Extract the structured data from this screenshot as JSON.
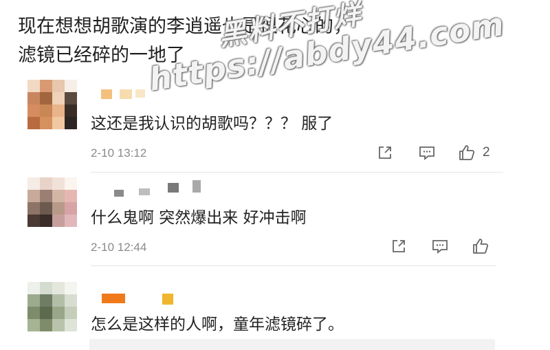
{
  "post": {
    "line1": "现在想想胡歌演的李逍遥也是很花心的，",
    "line2": "滤镜已经碎的一地了"
  },
  "watermark": {
    "line1": "黑料不打烊",
    "line2": "https://abdy44.com"
  },
  "comments": [
    {
      "text": "这还是我认识的胡歌吗？？？ 服了",
      "time": "2-10 13:12",
      "like_count": "2",
      "avatar_colors": [
        "#f2d9c4",
        "#d99a72",
        "#e7c7ad",
        "#f6eee7",
        "#c9865e",
        "#a2663f",
        "#efd2b8",
        "#5a4a3f",
        "#d58c5f",
        "#c98755",
        "#e9b48a",
        "#3a2d27",
        "#b86b3f",
        "#d6905f",
        "#f0c9a2",
        "#2b2523"
      ],
      "name_colors": [
        "#f3c07e",
        "#f6dcae",
        "#f9e6c6"
      ]
    },
    {
      "text": "什么鬼啊 突然爆出来 好冲击啊",
      "time": "2-10 12:44",
      "like_count": "",
      "avatar_colors": [
        "#f5ece6",
        "#e8d3c8",
        "#f1e2d9",
        "#fbf4ef",
        "#c7aa99",
        "#9a7f72",
        "#d4b6a7",
        "#e6b7b1",
        "#8d7466",
        "#6d5a4f",
        "#b89a8a",
        "#d8a3a5",
        "#4a3a33",
        "#3b2d29",
        "#c69f9c",
        "#e2b7bb"
      ],
      "name_colors": [
        "#8a8a8a",
        "#bdbdbd",
        "#7a7a7a",
        "#a9a9a9"
      ]
    },
    {
      "text": "怎么是这样的人啊，童年滤镜碎了。",
      "time": "",
      "like_count": "",
      "avatar_colors": [
        "#eef0ea",
        "#d4dbcf",
        "#e3e7de",
        "#f4f5f1",
        "#9cab8e",
        "#6f7d64",
        "#b3bea8",
        "#d7ddd0",
        "#7d8c6a",
        "#5c6a4d",
        "#9aa688",
        "#c5ceba",
        "#a6b494",
        "#7e8c6b",
        "#b9c3ab",
        "#dfe4d8"
      ],
      "name_colors": [
        "#f07a1a",
        "#f0b62d"
      ]
    }
  ],
  "icons": [
    "share-icon",
    "comment-icon",
    "like-icon"
  ]
}
